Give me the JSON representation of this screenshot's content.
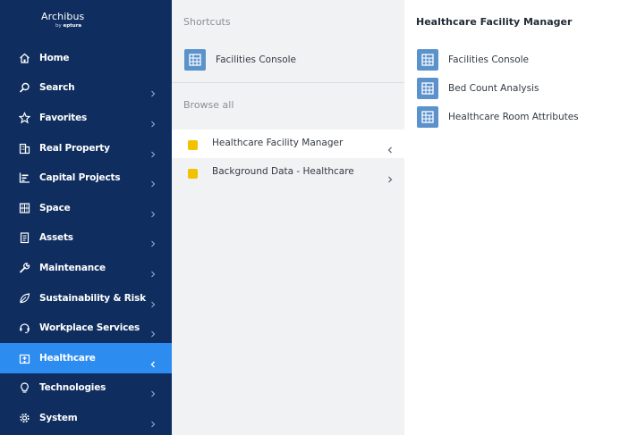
{
  "brand": {
    "name": "Archibus",
    "tagline_prefix": "by",
    "tagline_company": "eptura"
  },
  "sidebar": {
    "items": [
      {
        "label": "Home",
        "icon": "home-icon",
        "has_chevron": false,
        "active": false
      },
      {
        "label": "Search",
        "icon": "search-icon",
        "has_chevron": true,
        "active": false
      },
      {
        "label": "Favorites",
        "icon": "star-icon",
        "has_chevron": true,
        "active": false
      },
      {
        "label": "Real Property",
        "icon": "building-icon",
        "has_chevron": true,
        "active": false
      },
      {
        "label": "Capital Projects",
        "icon": "chart-icon",
        "has_chevron": true,
        "active": false
      },
      {
        "label": "Space",
        "icon": "floorplan-icon",
        "has_chevron": true,
        "active": false
      },
      {
        "label": "Assets",
        "icon": "clipboard-icon",
        "has_chevron": true,
        "active": false
      },
      {
        "label": "Maintenance",
        "icon": "wrench-icon",
        "has_chevron": true,
        "active": false
      },
      {
        "label": "Sustainability & Risk",
        "icon": "leaf-icon",
        "has_chevron": true,
        "active": false
      },
      {
        "label": "Workplace Services",
        "icon": "headset-icon",
        "has_chevron": true,
        "active": false
      },
      {
        "label": "Healthcare",
        "icon": "hospital-icon",
        "has_chevron": true,
        "active": true
      },
      {
        "label": "Technologies",
        "icon": "lightbulb-icon",
        "has_chevron": true,
        "active": false
      },
      {
        "label": "System",
        "icon": "gear-icon",
        "has_chevron": true,
        "active": false
      }
    ]
  },
  "middle": {
    "shortcuts_title": "Shortcuts",
    "shortcuts": [
      {
        "label": "Facilities Console",
        "icon": "table-icon"
      }
    ],
    "browse_title": "Browse all",
    "browse": [
      {
        "label": "Healthcare Facility Manager",
        "selected": true,
        "expanded": true
      },
      {
        "label": "Background Data - Healthcare",
        "selected": false,
        "expanded": false
      }
    ]
  },
  "right": {
    "title": "Healthcare Facility Manager",
    "items": [
      {
        "label": "Facilities Console",
        "icon": "table-icon"
      },
      {
        "label": "Bed Count Analysis",
        "icon": "table-icon"
      },
      {
        "label": "Healthcare Room Attributes",
        "icon": "table-icon"
      }
    ]
  },
  "colors": {
    "sidebar_bg": "#0f2e5f",
    "active_bg": "#2d8cf0",
    "middle_bg": "#f1f2f4",
    "tile_icon": "#5b92cc",
    "folder": "#f2c200"
  }
}
